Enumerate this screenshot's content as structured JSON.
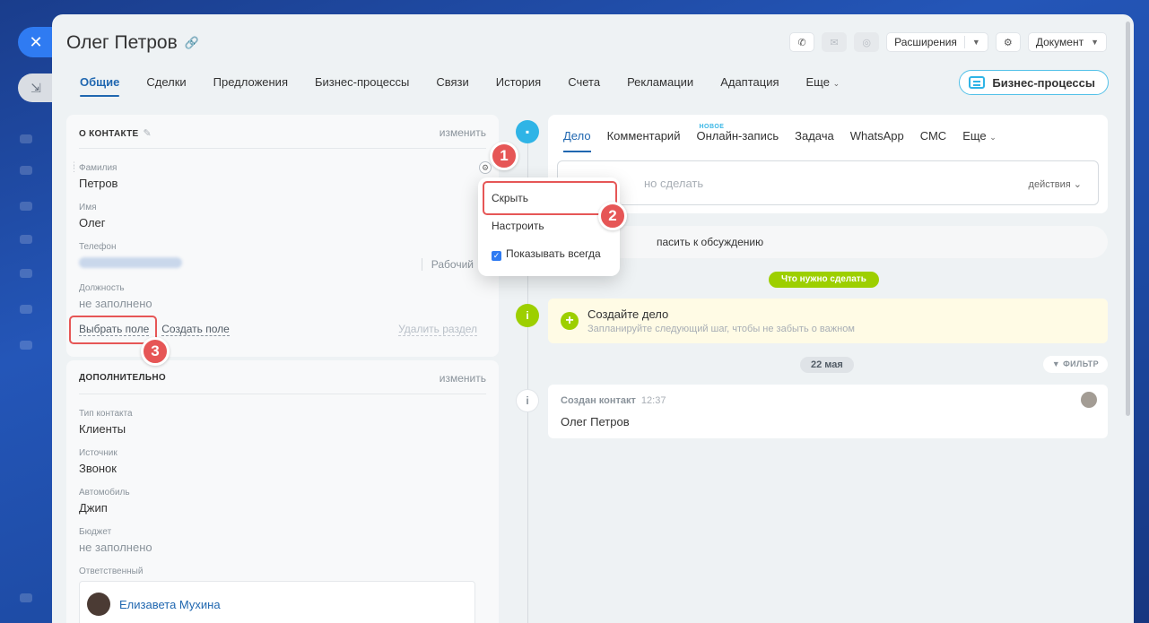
{
  "window": {
    "close_glyph": "✕",
    "minimize_glyph": "⇲"
  },
  "header": {
    "title": "Олег Петров",
    "extensions_label": "Расширения",
    "document_label": "Документ",
    "bp_button_label": "Бизнес-процессы"
  },
  "tabs": [
    {
      "label": "Общие",
      "active": true
    },
    {
      "label": "Сделки"
    },
    {
      "label": "Предложения"
    },
    {
      "label": "Бизнес-процессы"
    },
    {
      "label": "Связи"
    },
    {
      "label": "История"
    },
    {
      "label": "Счета"
    },
    {
      "label": "Рекламации"
    },
    {
      "label": "Адаптация"
    },
    {
      "label": "Еще"
    }
  ],
  "contact_card": {
    "title": "О КОНТАКТЕ",
    "edit_label": "изменить",
    "fields": {
      "last_name": {
        "label": "Фамилия",
        "value": "Петров"
      },
      "first_name": {
        "label": "Имя",
        "value": "Олег"
      },
      "phone": {
        "label": "Телефон",
        "type": "Рабочий"
      },
      "position": {
        "label": "Должность",
        "value": "не заполнено"
      }
    },
    "select_field": "Выбрать поле",
    "create_field": "Создать поле",
    "delete_section": "Удалить раздел"
  },
  "additional_card": {
    "title": "ДОПОЛНИТЕЛЬНО",
    "edit_label": "изменить",
    "fields": {
      "contact_type": {
        "label": "Тип контакта",
        "value": "Клиенты"
      },
      "source": {
        "label": "Источник",
        "value": "Звонок"
      },
      "car": {
        "label": "Автомобиль",
        "value": "Джип"
      },
      "budget": {
        "label": "Бюджет",
        "value": "не заполнено"
      },
      "responsible": {
        "label": "Ответственный",
        "value": "Елизавета Мухина"
      }
    }
  },
  "field_menu": {
    "hide": "Скрыть",
    "configure": "Настроить",
    "always_show": "Показывать всегда"
  },
  "annotations": {
    "one": "1",
    "two": "2",
    "three": "3"
  },
  "editor": {
    "tabs": [
      {
        "label": "Дело",
        "active": true
      },
      {
        "label": "Комментарий"
      },
      {
        "label": "Онлайн-запись",
        "tag": "НОВОЕ"
      },
      {
        "label": "Задача"
      },
      {
        "label": "WhatsApp"
      },
      {
        "label": "СМС"
      },
      {
        "label": "Еще"
      }
    ],
    "placeholder": "но сделать",
    "actions_label": "действия"
  },
  "discussion_text": "пасить к обсуждению",
  "timeline": {
    "todo_pill": "Что нужно сделать",
    "todo_title": "Создайте дело",
    "todo_subtitle": "Запланируйте следующий шаг, чтобы не забыть о важном",
    "date_pill": "22 мая",
    "filter_label": "ФИЛЬТР",
    "event_title": "Создан контакт",
    "event_time": "12:37",
    "event_body": "Олег Петров"
  },
  "colors": {
    "accent": "#2067b0",
    "annotation_red": "#e65656",
    "green": "#9dcf00"
  }
}
